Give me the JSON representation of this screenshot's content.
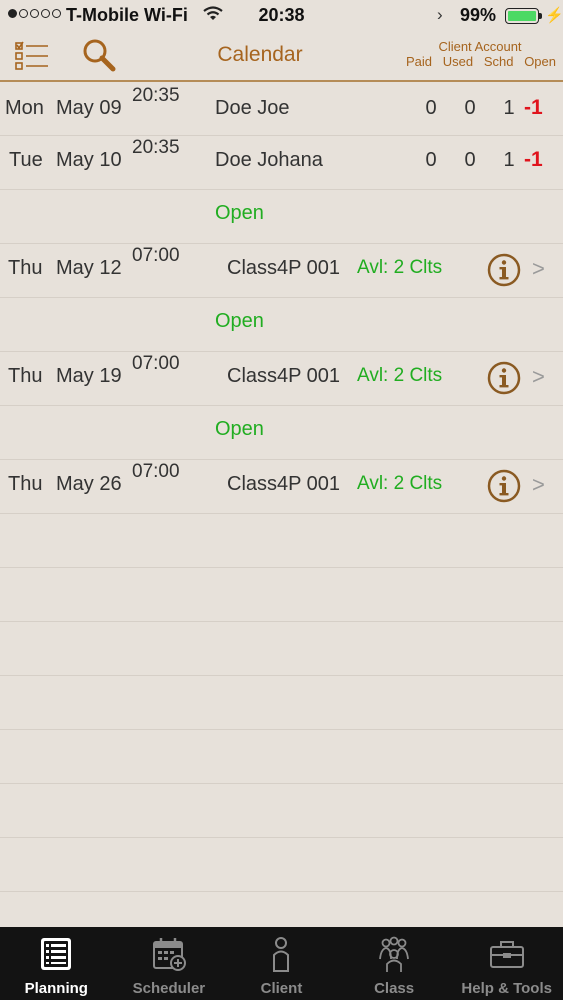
{
  "status_bar": {
    "carrier": "T-Mobile Wi-Fi",
    "time": "20:38",
    "battery": "99%"
  },
  "nav": {
    "title": "Calendar",
    "account_header": "Client Account",
    "columns": [
      "Paid",
      "Used",
      "Schd",
      "Open"
    ]
  },
  "rows": [
    {
      "type": "client",
      "day": "Mon",
      "date": "May 09",
      "time": "20:35",
      "name": "Doe Joe",
      "paid": "0",
      "used": "0",
      "schd": "1",
      "open": "-1"
    },
    {
      "type": "client",
      "day": "Tue",
      "date": "May 10",
      "time": "20:35",
      "name": "Doe Johana",
      "paid": "0",
      "used": "0",
      "schd": "1",
      "open": "-1"
    },
    {
      "type": "open",
      "label": "Open"
    },
    {
      "type": "class",
      "day": "Thu",
      "date": "May 12",
      "time": "07:00",
      "name": "Class4P 001",
      "avl": "Avl: 2 Clts"
    },
    {
      "type": "open",
      "label": "Open"
    },
    {
      "type": "class",
      "day": "Thu",
      "date": "May 19",
      "time": "07:00",
      "name": "Class4P 001",
      "avl": "Avl: 2 Clts"
    },
    {
      "type": "open",
      "label": "Open"
    },
    {
      "type": "class",
      "day": "Thu",
      "date": "May 26",
      "time": "07:00",
      "name": "Class4P 001",
      "avl": "Avl: 2 Clts"
    },
    {
      "type": "empty"
    },
    {
      "type": "empty"
    },
    {
      "type": "empty"
    },
    {
      "type": "empty"
    },
    {
      "type": "empty"
    },
    {
      "type": "empty"
    },
    {
      "type": "empty"
    },
    {
      "type": "empty"
    }
  ],
  "tabs": [
    {
      "label": "Planning",
      "icon": "planning-icon",
      "active": true
    },
    {
      "label": "Scheduler",
      "icon": "scheduler-icon",
      "active": false
    },
    {
      "label": "Client",
      "icon": "client-icon",
      "active": false
    },
    {
      "label": "Class",
      "icon": "class-icon",
      "active": false
    },
    {
      "label": "Help & Tools",
      "icon": "toolbox-icon",
      "active": false
    }
  ],
  "colors": {
    "background": "#e7e1da",
    "accent": "#a6641e",
    "open_green": "#21ad21",
    "negative_red": "#e0141d",
    "tabbar": "#131313"
  }
}
